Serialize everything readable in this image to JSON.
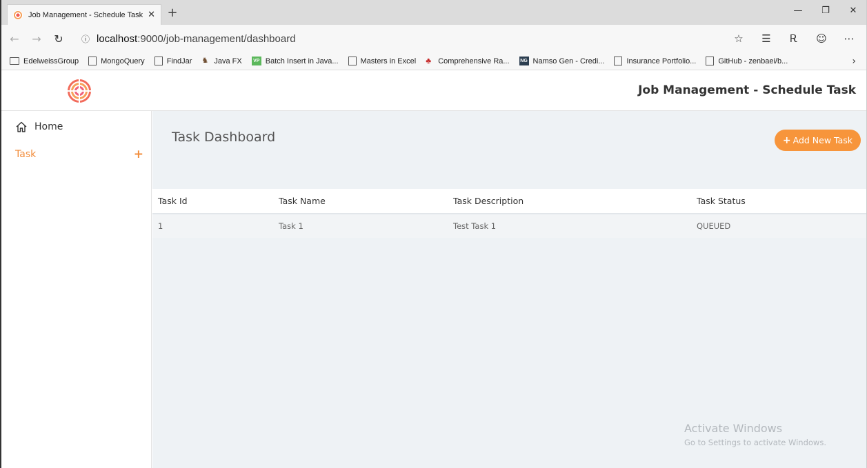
{
  "browser": {
    "tab_title": "Job Management - Schedule Task",
    "tab_close": "✕",
    "new_tab": "+",
    "url_host": "localhost",
    "url_path": ":9000/job-management/dashboard",
    "window_controls": {
      "minimize": "—",
      "restore": "❐",
      "close": "✕"
    },
    "icons": [
      "back-icon",
      "forward-icon",
      "refresh-icon",
      "info-icon",
      "favorite-star-icon",
      "favorites-list-icon",
      "profile-icon",
      "emoji-icon",
      "more-icon"
    ]
  },
  "favorites": [
    {
      "label": "EdelweissGroup",
      "icon": "folder"
    },
    {
      "label": "MongoQuery",
      "icon": "page"
    },
    {
      "label": "FindJar",
      "icon": "page"
    },
    {
      "label": "Java FX",
      "icon": "horse"
    },
    {
      "label": "Batch Insert in Java...",
      "icon": "vp",
      "badge": "VP"
    },
    {
      "label": "Masters in Excel",
      "icon": "page"
    },
    {
      "label": "Comprehensive Ra...",
      "icon": "leaf"
    },
    {
      "label": "Namso Gen - Credi...",
      "icon": "ng",
      "badge": "NG"
    },
    {
      "label": "Insurance Portfolio...",
      "icon": "page"
    },
    {
      "label": "GitHub - zenbaei/b...",
      "icon": "page"
    }
  ],
  "header": {
    "title": "Job Management - Schedule Task"
  },
  "sidebar": {
    "items": [
      {
        "label": "Home"
      },
      {
        "label": "Task",
        "action": "+"
      }
    ]
  },
  "main": {
    "title": "Task Dashboard",
    "add_button": "Add New Task",
    "table": {
      "columns": [
        "Task Id",
        "Task Name",
        "Task Description",
        "Task Status"
      ],
      "rows": [
        [
          "1",
          "Task 1",
          "Test Task 1",
          "QUEUED"
        ]
      ]
    }
  },
  "watermark": {
    "line1": "Activate Windows",
    "line2": "Go to Settings to activate Windows."
  },
  "colors": {
    "accent": "#f7953b",
    "sidebar_active": "#f28d3c",
    "content_bg": "#eef2f5"
  }
}
